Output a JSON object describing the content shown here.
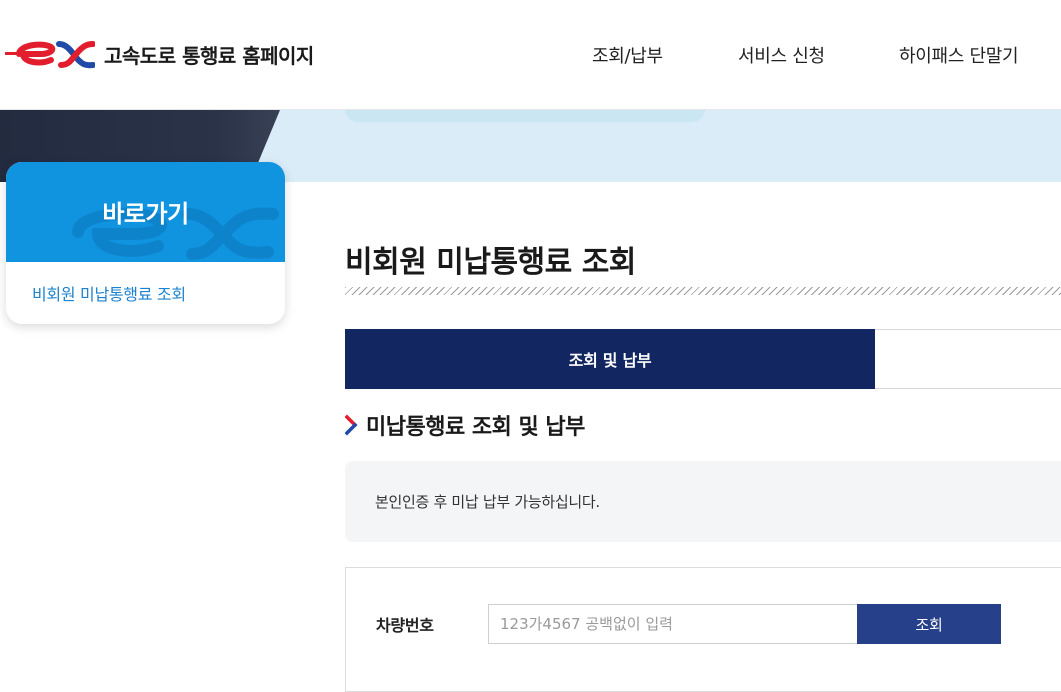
{
  "header": {
    "logo_text": "고속도로 통행료 홈페이지",
    "nav": [
      "조회/납부",
      "서비스 신청",
      "하이패스 단말기"
    ]
  },
  "sidebar": {
    "title": "바로가기",
    "link": "비회원 미납통행료 조회"
  },
  "main": {
    "page_title": "비회원 미납통행료 조회",
    "tabs": [
      {
        "label": "조회 및 납부",
        "active": true
      },
      {
        "label": "",
        "active": false
      }
    ],
    "section_title": "미납통행료 조회 및 납부",
    "notice": "본인인증 후 미납 납부 가능하십니다.",
    "form": {
      "label": "차량번호",
      "input_value": "",
      "input_placeholder": "123가4567 공백없이 입력",
      "button_label": "조회"
    }
  },
  "colors": {
    "brand_red": "#e11d2e",
    "brand_blue": "#1f4aa8",
    "sidebar_blue": "#1094e0",
    "tab_navy": "#122661",
    "button_blue": "#26408a"
  },
  "icons": {
    "logo": "ex-logo-icon",
    "section": "chevron-right-icon"
  }
}
